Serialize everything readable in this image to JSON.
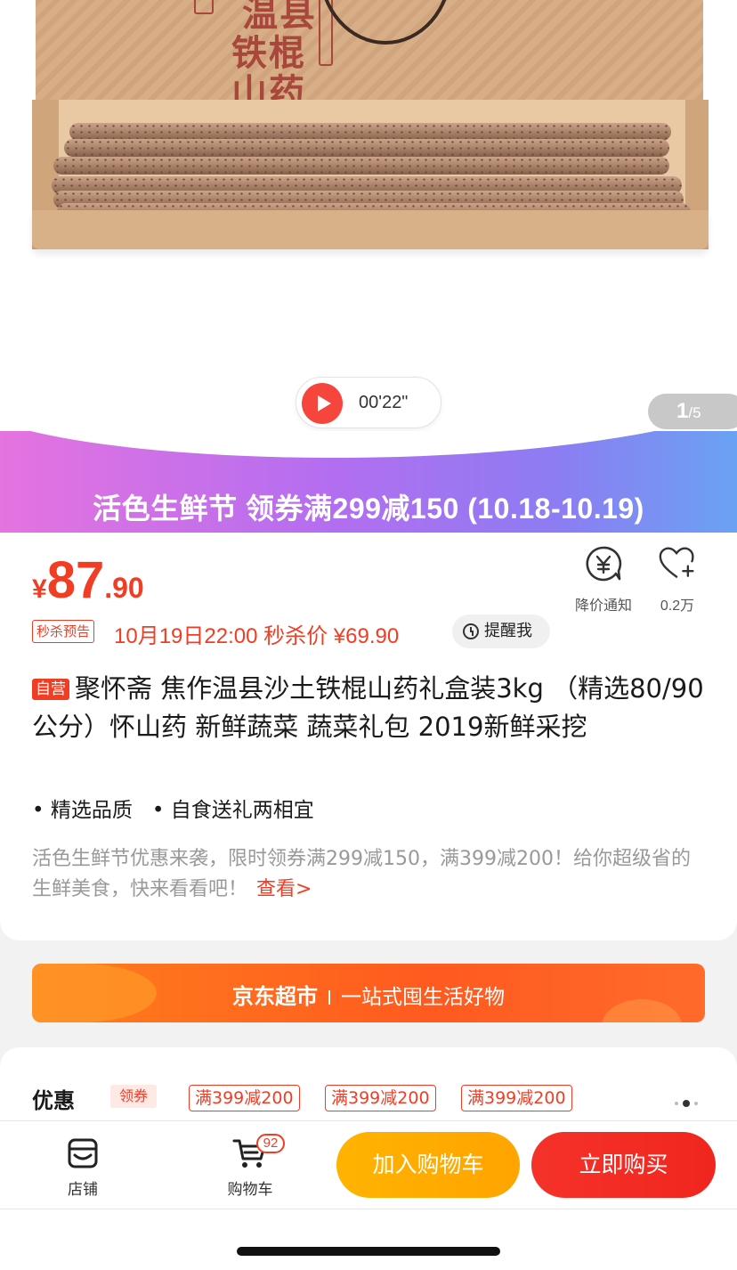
{
  "hero": {
    "lid_text": [
      "温县",
      "铁棍",
      "山药"
    ],
    "video": {
      "duration": "00'22\""
    },
    "counter": {
      "current": "1",
      "total": "/5"
    }
  },
  "promo": {
    "text": "活色生鲜节 领券满299减150 (10.18-10.19)"
  },
  "price": {
    "currency": "¥",
    "integer": "87",
    "decimal": ".90"
  },
  "actions": {
    "notify_label": "降价通知",
    "fav_count": "0.2万"
  },
  "flash_sale": {
    "tag": "秒杀预告",
    "text": "10月19日22:00 秒杀价 ¥69.90",
    "remind_label": "提醒我"
  },
  "product": {
    "self_tag": "自营",
    "title": "聚怀斋 焦作温县沙土铁棍山药礼盒装3kg （精选80/90公分）怀山药 新鲜蔬菜  蔬菜礼包 2019新鲜采挖",
    "features": [
      "• 精选品质",
      "• 自食送礼两相宜"
    ],
    "desc": "活色生鲜节优惠来袭，限时领券满299减150，满399减200！给你超级省的生鲜美食，快来看看吧！",
    "more_link": "查看>"
  },
  "supermarket": {
    "brand": "京东超市",
    "slogan": "一站式囤生活好物"
  },
  "offers": {
    "title": "优惠",
    "coupon_tag": "领券",
    "coupons": [
      "满399减200",
      "满399减200",
      "满399减200"
    ]
  },
  "bottom_bar": {
    "store_label": "店铺",
    "cart_label": "购物车",
    "cart_badge": "92",
    "add_cart_label": "加入购物车",
    "buy_now_label": "立即购买"
  },
  "colors": {
    "accent": "#f23d25",
    "cart_button": "#ffb300",
    "buy_button": "#f0261e"
  }
}
